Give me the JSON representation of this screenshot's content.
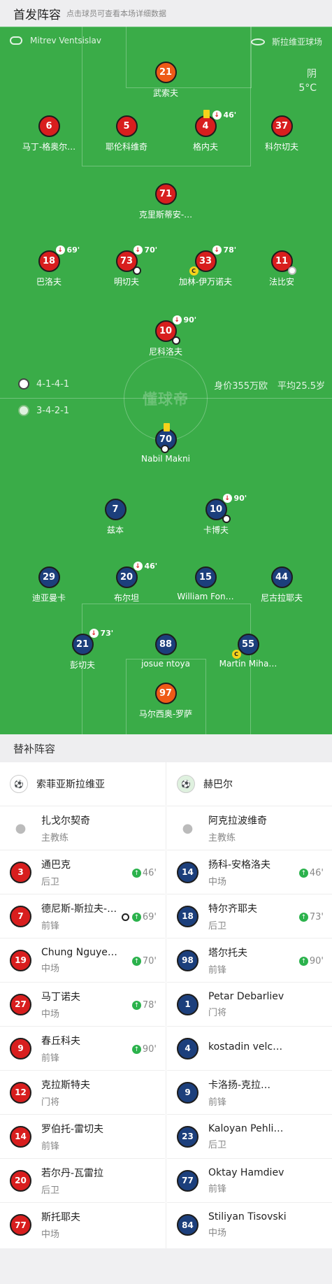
{
  "header": {
    "title": "首发阵容",
    "hint": "点击球员可查看本场详细数据"
  },
  "match": {
    "referee": "Mitrev Ventsislav",
    "venue": "斯拉维亚球场",
    "weather": "阴",
    "temp": "5°C",
    "watermark": "懂球帝"
  },
  "home": {
    "formation": "4-1-4-1",
    "market": "身价355万欧",
    "avg_age": "平均25.5岁"
  },
  "away": {
    "formation": "3-4-2-1"
  },
  "home_players": [
    {
      "num": "21",
      "name": "武索夫"
    },
    {
      "num": "6",
      "name": "马丁-格奥尔…"
    },
    {
      "num": "5",
      "name": "耶伦科维奇"
    },
    {
      "num": "4",
      "name": "格内夫",
      "sub": "46'"
    },
    {
      "num": "37",
      "name": "科尔切夫"
    },
    {
      "num": "71",
      "name": "克里斯蒂安-…"
    },
    {
      "num": "18",
      "name": "巴洛夫",
      "sub": "69'"
    },
    {
      "num": "73",
      "name": "明切夫",
      "sub": "70'"
    },
    {
      "num": "33",
      "name": "加林-伊万诺夫",
      "sub": "78'"
    },
    {
      "num": "11",
      "name": "法比安"
    },
    {
      "num": "10",
      "name": "尼科洛夫",
      "sub": "90'"
    }
  ],
  "away_players": [
    {
      "num": "70",
      "name": "Nabil Makni"
    },
    {
      "num": "7",
      "name": "兹本"
    },
    {
      "num": "10",
      "name": "卡博夫",
      "sub": "90'"
    },
    {
      "num": "29",
      "name": "迪亚曼卡"
    },
    {
      "num": "20",
      "name": "布尔坦",
      "sub": "46'"
    },
    {
      "num": "15",
      "name": "William Fon…"
    },
    {
      "num": "44",
      "name": "尼古拉耶夫"
    },
    {
      "num": "21",
      "name": "彭切夫",
      "sub": "73'"
    },
    {
      "num": "88",
      "name": "josue ntoya"
    },
    {
      "num": "55",
      "name": "Martin Miha…"
    },
    {
      "num": "97",
      "name": "马尔西奥-罗萨"
    }
  ],
  "subs": {
    "title": "替补阵容",
    "home_team": "索菲亚斯拉维亚",
    "away_team": "赫巴尔",
    "home_coach": {
      "name": "扎戈尔契奇",
      "role": "主教练"
    },
    "away_coach": {
      "name": "阿克拉波维奇",
      "role": "主教练"
    },
    "home": [
      {
        "num": "3",
        "name": "通巴克",
        "pos": "后卫",
        "in": "46'"
      },
      {
        "num": "7",
        "name": "德尼斯-斯拉夫-…",
        "pos": "前锋",
        "in": "69'",
        "goal": true
      },
      {
        "num": "19",
        "name": "Chung Nguye…",
        "pos": "中场",
        "in": "70'"
      },
      {
        "num": "27",
        "name": "马丁诺夫",
        "pos": "中场",
        "in": "78'"
      },
      {
        "num": "9",
        "name": "春丘科夫",
        "pos": "前锋",
        "in": "90'"
      },
      {
        "num": "12",
        "name": "克拉斯特夫",
        "pos": "门将"
      },
      {
        "num": "14",
        "name": "罗伯托-雷切夫",
        "pos": "前锋"
      },
      {
        "num": "20",
        "name": "若尔丹-瓦雷拉",
        "pos": "后卫"
      },
      {
        "num": "77",
        "name": "斯托耶夫",
        "pos": "中场"
      }
    ],
    "away": [
      {
        "num": "14",
        "name": "扬科-安格洛夫",
        "pos": "中场",
        "in": "46'"
      },
      {
        "num": "18",
        "name": "特尔齐耶夫",
        "pos": "后卫",
        "in": "73'"
      },
      {
        "num": "98",
        "name": "塔尔托夫",
        "pos": "前锋",
        "in": "90'"
      },
      {
        "num": "1",
        "name": "Petar Debarliev",
        "pos": "门将"
      },
      {
        "num": "4",
        "name": "kostadin velc…",
        "pos": ""
      },
      {
        "num": "9",
        "name": "卡洛扬-克拉…",
        "pos": "前锋"
      },
      {
        "num": "23",
        "name": "Kaloyan Pehli…",
        "pos": "后卫"
      },
      {
        "num": "77",
        "name": "Oktay Hamdiev",
        "pos": "前锋"
      },
      {
        "num": "84",
        "name": "Stiliyan Tisovski",
        "pos": "中场"
      }
    ]
  },
  "colors": {
    "pitch": "#3aac48",
    "home": "#d81e1e",
    "away": "#1c3f7c",
    "keeper": "#ee5a17"
  }
}
